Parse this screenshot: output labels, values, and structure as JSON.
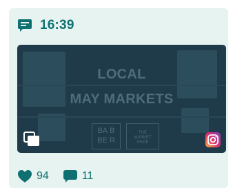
{
  "post": {
    "time": "16:39",
    "media": {
      "headline_line1": "LOCAL",
      "headline_line2": "MAY MARKETS",
      "sign_left": "BA B\nBE R",
      "sign_right": "THE\nMARKET\nSHOP",
      "gallery_icon": "multiple-images-icon",
      "platform_icon": "instagram-icon"
    },
    "stats": {
      "likes": "94",
      "comments": "11",
      "like_icon": "heart-icon",
      "comment_icon": "comment-icon"
    }
  },
  "colors": {
    "card_background": "#e6f3f0",
    "accent": "#0e7070",
    "media_background": "#1f3b49"
  }
}
